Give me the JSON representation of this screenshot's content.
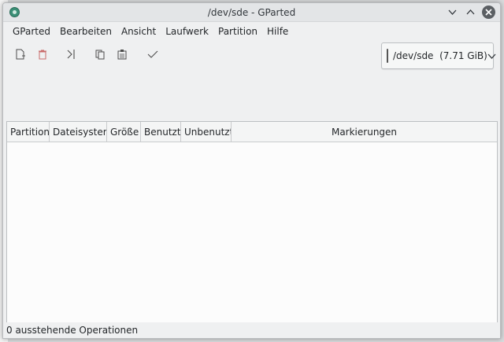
{
  "window": {
    "title": "/dev/sde - GParted"
  },
  "menu": [
    {
      "label": "GParted"
    },
    {
      "label": "Bearbeiten"
    },
    {
      "label": "Ansicht"
    },
    {
      "label": "Laufwerk"
    },
    {
      "label": "Partition"
    },
    {
      "label": "Hilfe"
    }
  ],
  "toolbar": {
    "icons": [
      "new-partition-icon",
      "delete-partition-icon",
      "resize-move-icon",
      "copy-icon",
      "paste-icon",
      "apply-icon"
    ]
  },
  "device": {
    "label": "/dev/sde  (7.71 GiB)"
  },
  "table": {
    "columns": [
      "Partition",
      "Dateisystem",
      "Größe",
      "Benutzt",
      "Unbenutzt",
      "Markierungen"
    ]
  },
  "status": {
    "text": "0 ausstehende Operationen"
  },
  "colors": {
    "accent": "#3a8f76"
  }
}
